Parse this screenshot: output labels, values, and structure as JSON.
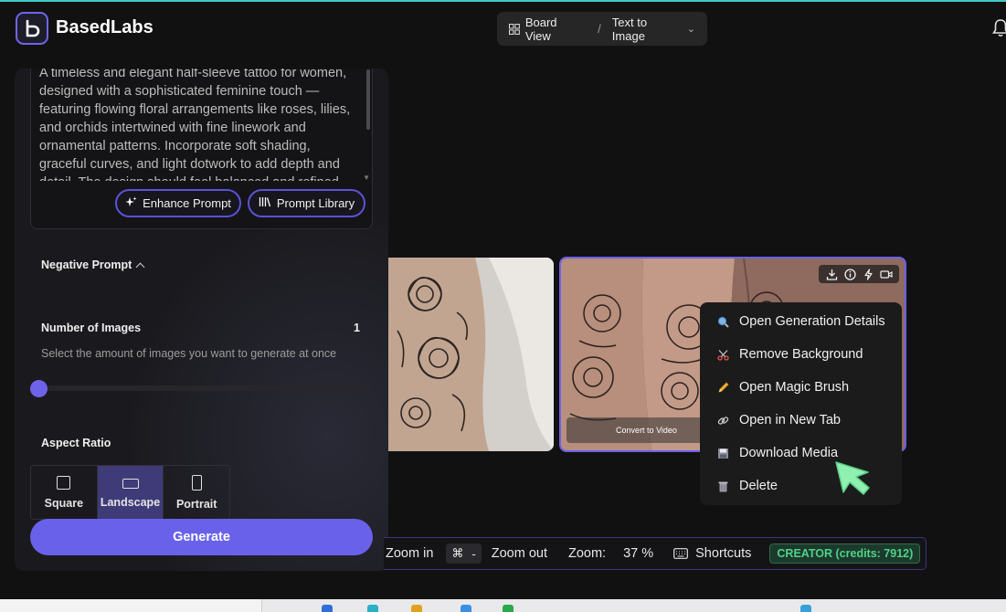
{
  "app": {
    "name": "BasedLabs",
    "brand_color": "#6a61ea"
  },
  "header": {
    "view_label": "Board View",
    "separator": "/",
    "mode_label": "Text to Image",
    "icons": [
      "grid-icon",
      "chevron-down-icon",
      "bell-icon"
    ]
  },
  "prompt": {
    "text": "A timeless and elegant half-sleeve tattoo for women, designed with a sophisticated feminine touch — featuring flowing floral arrangements like roses, lilies, and orchids intertwined with fine linework and ornamental patterns. Incorporate soft shading, graceful curves, and light dotwork to add depth and detail. The design should feel balanced and refined,",
    "enhance_label": "Enhance Prompt",
    "library_label": "Prompt Library"
  },
  "negative_prompt": {
    "label": "Negative Prompt"
  },
  "number_of_images": {
    "label": "Number of Images",
    "value": "1",
    "helper": "Select the amount of images you want to generate at once",
    "slider_fraction": 0
  },
  "aspect_ratio": {
    "label": "Aspect Ratio",
    "options": [
      {
        "label": "Square",
        "icon": "square-icon"
      },
      {
        "label": "Landscape",
        "icon": "landscape-icon"
      },
      {
        "label": "Portrait",
        "icon": "portrait-icon"
      }
    ],
    "selected": "Landscape"
  },
  "generate_label": "Generate",
  "image_card": {
    "convert_label": "Convert to Video",
    "toolbar_icons": [
      "download-icon",
      "info-icon",
      "bolt-icon",
      "video-icon"
    ]
  },
  "context_menu": {
    "items": [
      {
        "label": "Open Generation Details",
        "icon": "magnifier-icon"
      },
      {
        "label": "Remove Background",
        "icon": "scissors-icon"
      },
      {
        "label": "Open Magic Brush",
        "icon": "pencil-icon"
      },
      {
        "label": "Open in New Tab",
        "icon": "link-icon"
      },
      {
        "label": "Download Media",
        "icon": "floppy-disk-icon"
      },
      {
        "label": "Delete",
        "icon": "trash-icon"
      }
    ]
  },
  "bottom_bar": {
    "zoom_in_label": "Zoom in",
    "cmd_key": "⌘",
    "minus_key": "-",
    "zoom_out_label": "Zoom out",
    "zoom_label": "Zoom:",
    "zoom_value": "37 %",
    "shortcuts_label": "Shortcuts",
    "credits_label": "CREATOR (credits: 7912)"
  }
}
